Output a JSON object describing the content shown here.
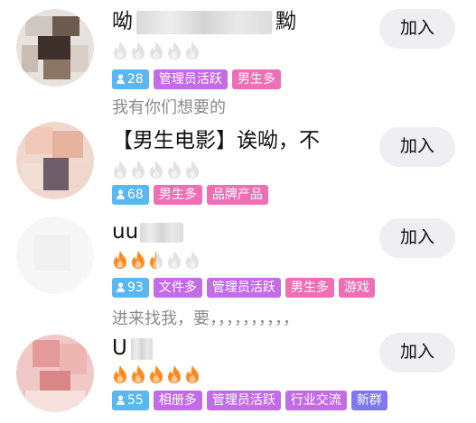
{
  "groups": [
    {
      "name_prefix": "呦",
      "name_suffix": "黝",
      "heat": 0,
      "member_count": "28",
      "tags": [
        {
          "label": "管理员活跃",
          "color": "#c46be8"
        },
        {
          "label": "男生多",
          "color": "#ee6fb6"
        }
      ],
      "description": "我有你们想要的",
      "join_label": "加入"
    },
    {
      "name_prefix": "【男生电影】诶呦，不",
      "name_suffix": "",
      "heat": 0,
      "member_count": "68",
      "tags": [
        {
          "label": "男生多",
          "color": "#ee6fb6"
        },
        {
          "label": "品牌产品",
          "color": "#ee6fb6"
        }
      ],
      "description": "",
      "join_label": "加入"
    },
    {
      "name_prefix": "uu",
      "name_suffix": "",
      "heat": 2.5,
      "member_count": "93",
      "tags": [
        {
          "label": "文件多",
          "color": "#c46be8"
        },
        {
          "label": "管理员活跃",
          "color": "#c46be8"
        },
        {
          "label": "男生多",
          "color": "#ee6fb6"
        },
        {
          "label": "游戏",
          "color": "#ee6fb6"
        }
      ],
      "description": "进来找我，要，，，，，，，，，，",
      "join_label": "加入"
    },
    {
      "name_prefix": "U",
      "name_suffix": "",
      "heat": 5,
      "member_count": "55",
      "tags": [
        {
          "label": "相册多",
          "color": "#c46be8"
        },
        {
          "label": "管理员活跃",
          "color": "#c46be8"
        },
        {
          "label": "行业交流",
          "color": "#c46be8"
        },
        {
          "label": "新群",
          "color": "#7e76f3"
        }
      ],
      "description": "",
      "join_label": "加入"
    }
  ],
  "colors": {
    "flame_lit": "#ff8a1f",
    "flame_dim": "#e2e2e2",
    "count_badge": "#5bb7f0",
    "join_bg": "#eeeef3"
  },
  "icons": {
    "person": "person-icon",
    "heat": "flame-icon"
  }
}
